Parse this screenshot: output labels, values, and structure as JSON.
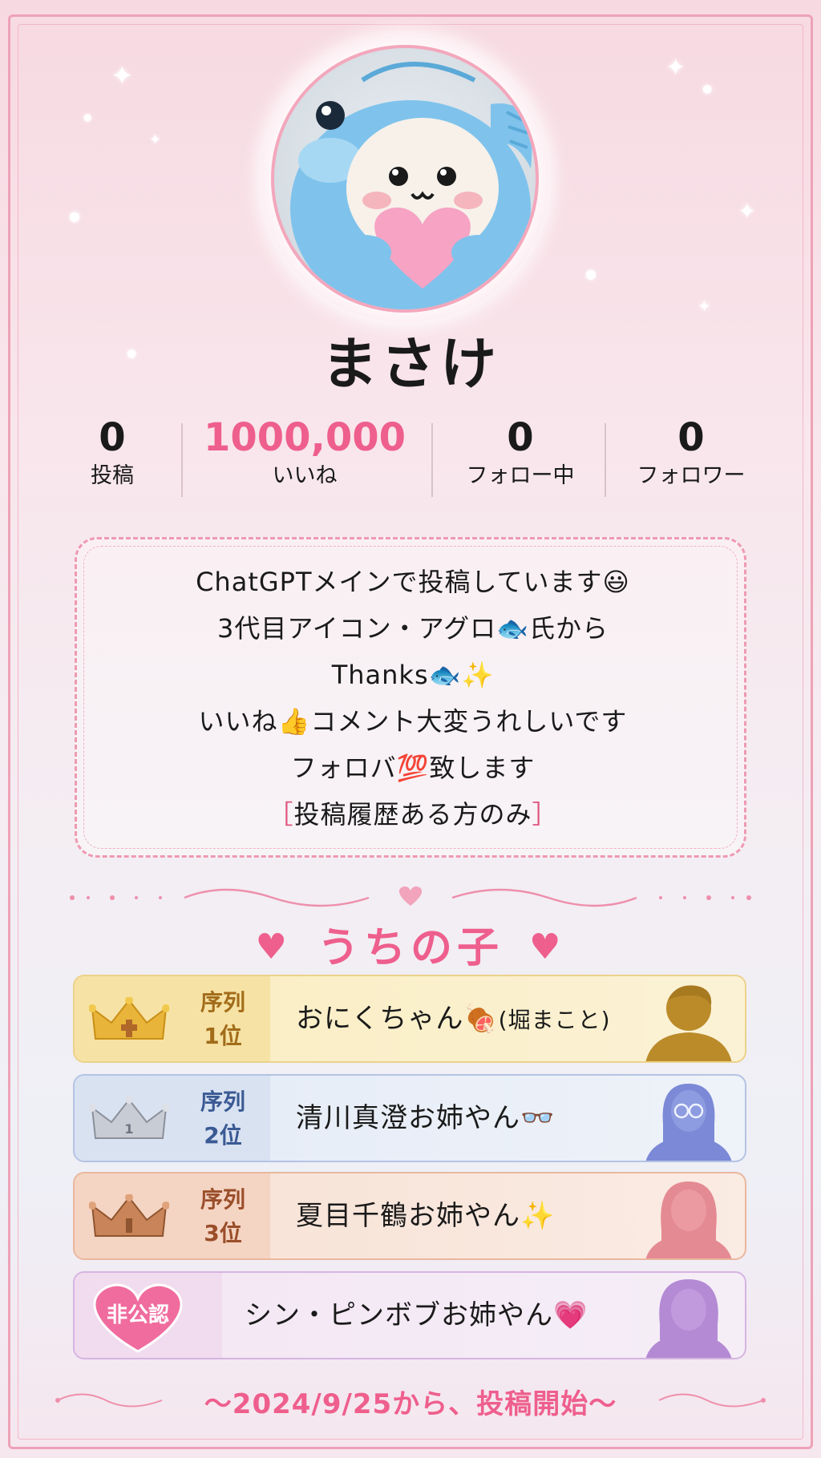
{
  "profile": {
    "username": "まさけ"
  },
  "stats": [
    {
      "value": "0",
      "label": "投稿"
    },
    {
      "value": "1000,000",
      "label": "いいね"
    },
    {
      "value": "0",
      "label": "フォロー中"
    },
    {
      "value": "0",
      "label": "フォロワー"
    }
  ],
  "bio": {
    "line1": "ChatGPTメインで投稿しています😃",
    "line2": "3代目アイコン・アグロ🐟氏から",
    "line3": "Thanks🐟✨",
    "line4": "いいね👍コメント大変うれしいです",
    "line5": "フォロバ💯致します",
    "line6_open": "［",
    "line6_text": "投稿履歴ある方のみ",
    "line6_close": "］"
  },
  "section": {
    "heart": "♥",
    "title": "うちの子"
  },
  "ranks": [
    {
      "tag_line1": "序列",
      "tag_line2": "1位",
      "name": "おにくちゃん🍖",
      "note": "(堀まこと)"
    },
    {
      "tag_line1": "序列",
      "tag_line2": "2位",
      "name": "清川真澄お姉やん👓"
    },
    {
      "tag_line1": "序列",
      "tag_line2": "3位",
      "name": "夏目千鶴お姉やん✨"
    },
    {
      "badge": "非公認",
      "name": "シン・ピンボブお姉やん💗"
    }
  ],
  "footer": {
    "text": "〜2024/9/25から、投稿開始〜"
  },
  "colors": {
    "accent_pink": "#ee5f8d",
    "gold": "#f0d27a",
    "silver": "#aebbd8",
    "bronze": "#e8b79c",
    "lavender": "#cfb4e4"
  }
}
